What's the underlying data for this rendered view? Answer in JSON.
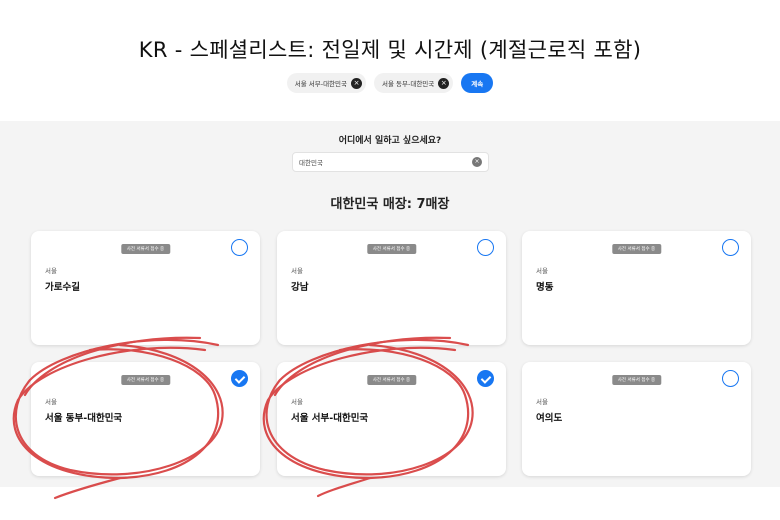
{
  "header": {
    "title": "KR - 스페셜리스트: 전일제 및 시간제 (계절근로직 포함)",
    "chips": [
      {
        "label": "서울 서부-대한민국"
      },
      {
        "label": "서울 동부-대한민국"
      }
    ],
    "continue_label": "계속"
  },
  "search": {
    "question": "어디에서 일하고 싶으세요?",
    "value": "대한민국"
  },
  "results": {
    "count_label": "대한민국 매장: 7매장",
    "cards": [
      {
        "badge": "사전 서류서 접수 중",
        "city": "서울",
        "name": "가로수길",
        "checked": false
      },
      {
        "badge": "사전 서류서 접수 중",
        "city": "서울",
        "name": "강남",
        "checked": false
      },
      {
        "badge": "사전 서류서 접수 중",
        "city": "서울",
        "name": "명동",
        "checked": false
      },
      {
        "badge": "사전 서류서 접수 중",
        "city": "서울",
        "name": "서울 동부-대한민국",
        "checked": true
      },
      {
        "badge": "사전 서류서 접수 중",
        "city": "서울",
        "name": "서울 서부-대한민국",
        "checked": true
      },
      {
        "badge": "사전 서류서 접수 중",
        "city": "서울",
        "name": "여의도",
        "checked": false
      }
    ]
  },
  "colors": {
    "accent": "#1877f2",
    "annotation": "#d63a3a",
    "panel_bg": "#f4f4f4"
  }
}
